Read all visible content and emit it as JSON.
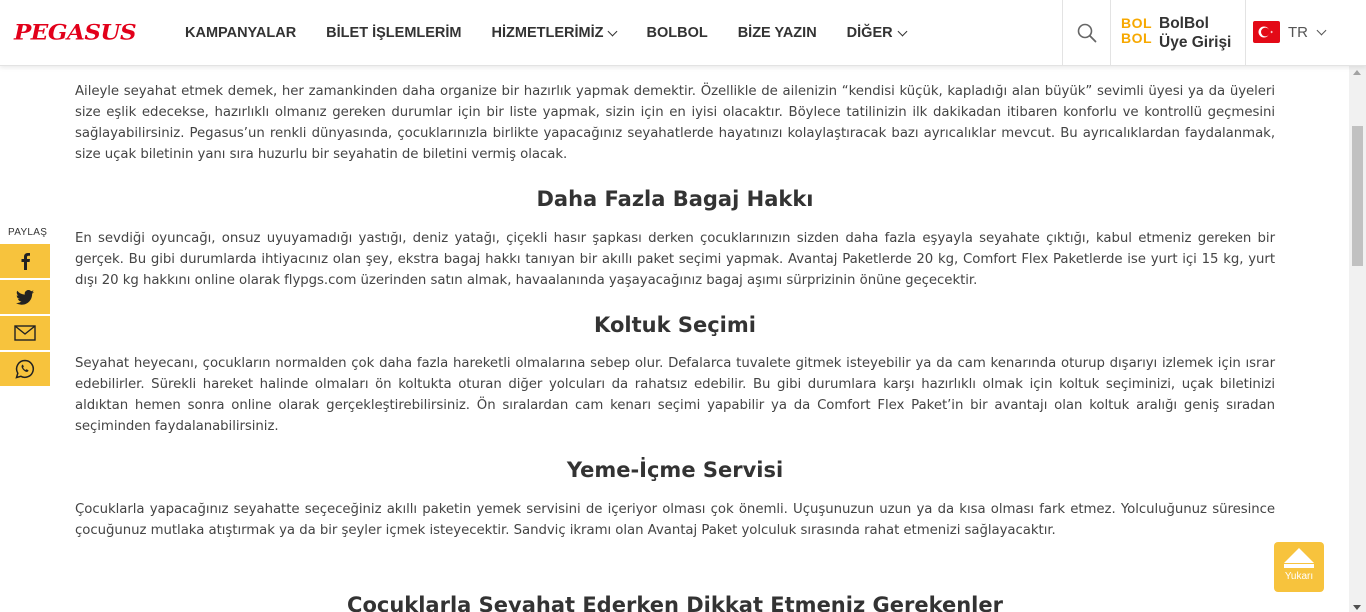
{
  "header": {
    "logo": "PEGASUS",
    "nav": [
      {
        "label": "KAMPANYALAR",
        "dropdown": false
      },
      {
        "label": "BİLET İŞLEMLERİM",
        "dropdown": false
      },
      {
        "label": "HİZMETLERİMİZ",
        "dropdown": true
      },
      {
        "label": "BOLBOL",
        "dropdown": false
      },
      {
        "label": "BİZE YAZIN",
        "dropdown": false
      },
      {
        "label": "DİĞER",
        "dropdown": true
      }
    ],
    "search_icon": "search-icon",
    "bolbol_logo_line1": "BOL",
    "bolbol_logo_line2": "BOL",
    "bolbol_line1": "BolBol",
    "bolbol_line2": "Üye Girişi",
    "language": "TR",
    "flag": "turkey-flag-icon",
    "brand_color": "#e2001a",
    "accent_color": "#f7a800"
  },
  "share": {
    "label": "PAYLAŞ",
    "buttons": [
      "facebook-icon",
      "twitter-icon",
      "email-icon",
      "whatsapp-icon"
    ],
    "color": "#f7c33d"
  },
  "content": {
    "intro": "Aileyle seyahat etmek demek, her zamankinden daha organize bir hazırlık yapmak demektir. Özellikle de ailenizin “kendisi küçük, kapladığı alan büyük” sevimli üyesi ya da üyeleri size eşlik edecekse, hazırlıklı olmanız gereken durumlar için bir liste yapmak, sizin için en iyisi olacaktır. Böylece tatilinizin ilk dakikadan itibaren konforlu ve kontrollü geçmesini sağlayabilirsiniz.  Pegasus’un renkli dünyasında, çocuklarınızla birlikte yapacağınız seyahatlerde hayatınızı kolaylaştıracak bazı ayrıcalıklar mevcut. Bu ayrıcalıklardan faydalanmak, size uçak biletinin yanı sıra huzurlu bir seyahatin de biletini vermiş olacak.",
    "sections": [
      {
        "heading": "Daha Fazla Bagaj Hakkı",
        "text": "En sevdiği oyuncağı, onsuz uyuyamadığı yastığı, deniz yatağı, çiçekli hasır şapkası derken çocuklarınızın sizden daha fazla eşyayla seyahate çıktığı, kabul etmeniz gereken bir gerçek. Bu gibi durumlarda ihtiyacınız olan şey, ekstra bagaj hakkı tanıyan bir akıllı paket seçimi yapmak. Avantaj Paketlerde 20 kg, Comfort Flex Paketlerde ise yurt içi 15 kg, yurt dışı 20 kg hakkını online olarak flypgs.com üzerinden satın almak, havaalanında yaşayacağınız bagaj aşımı sürprizinin önüne geçecektir."
      },
      {
        "heading": "Koltuk Seçimi",
        "text": "Seyahat heyecanı, çocukların normalden çok daha fazla hareketli olmalarına sebep olur. Defalarca tuvalete gitmek isteyebilir ya da cam kenarında oturup dışarıyı izlemek için ısrar edebilirler. Sürekli hareket halinde olmaları ön koltukta oturan diğer yolcuları da rahatsız edebilir. Bu gibi durumlara karşı hazırlıklı olmak için koltuk seçiminizi, uçak biletinizi aldıktan hemen sonra online olarak gerçekleştirebilirsiniz. Ön sıralardan cam kenarı seçimi yapabilir ya da Comfort Flex Paket’in bir avantajı olan koltuk aralığı geniş sıradan seçiminden faydalanabilirsiniz."
      },
      {
        "heading": "Yeme-İçme Servisi",
        "text": "Çocuklarla yapacağınız seyahatte seçeceğiniz akıllı paketin yemek servisini de içeriyor olması çok önemli. Uçuşunuzun uzun ya da kısa olması fark etmez. Yolculuğunuz süresince çocuğunuz mutlaka atıştırmak ya da bir şeyler içmek isteyecektir. Sandviç ikramı olan Avantaj Paket yolculuk sırasında rahat etmenizi sağlayacaktır."
      }
    ],
    "next_heading": "Çocuklarla Seyahat Ederken Dikkat Etmeniz Gerekenler"
  },
  "back_to_top": {
    "label": "Yukarı",
    "icon": "arrow-up-icon"
  }
}
